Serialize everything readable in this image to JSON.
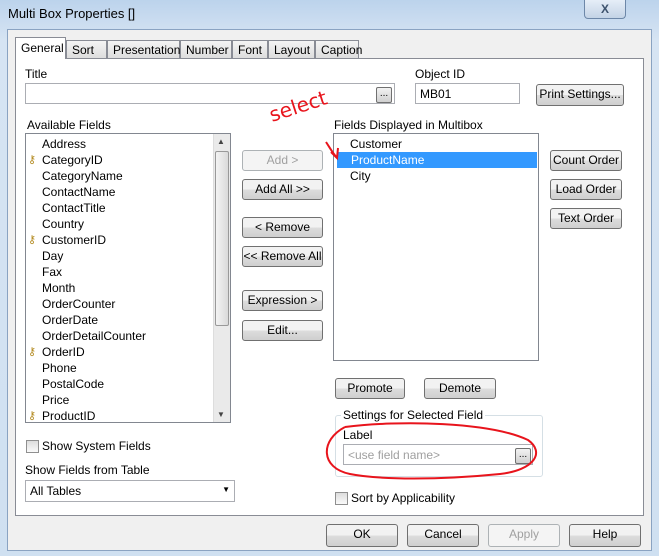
{
  "window": {
    "title": "Multi Box Properties []",
    "close": "X"
  },
  "tabs": [
    "General",
    "Sort",
    "Presentation",
    "Number",
    "Font",
    "Layout",
    "Caption"
  ],
  "title_label": "Title",
  "title_value": "",
  "browse": "...",
  "object_id_label": "Object ID",
  "object_id_value": "MB01",
  "print_settings": "Print Settings...",
  "available_label": "Available Fields",
  "available_fields": [
    {
      "name": "Address",
      "key": false
    },
    {
      "name": "CategoryID",
      "key": true
    },
    {
      "name": "CategoryName",
      "key": false
    },
    {
      "name": "ContactName",
      "key": false
    },
    {
      "name": "ContactTitle",
      "key": false
    },
    {
      "name": "Country",
      "key": false
    },
    {
      "name": "CustomerID",
      "key": true
    },
    {
      "name": "Day",
      "key": false
    },
    {
      "name": "Fax",
      "key": false
    },
    {
      "name": "Month",
      "key": false
    },
    {
      "name": "OrderCounter",
      "key": false
    },
    {
      "name": "OrderDate",
      "key": false
    },
    {
      "name": "OrderDetailCounter",
      "key": false
    },
    {
      "name": "OrderID",
      "key": true
    },
    {
      "name": "Phone",
      "key": false
    },
    {
      "name": "PostalCode",
      "key": false
    },
    {
      "name": "Price",
      "key": false
    },
    {
      "name": "ProductID",
      "key": true
    }
  ],
  "buttons": {
    "add": "Add >",
    "add_all": "Add All >>",
    "remove": "< Remove",
    "remove_all": "<< Remove All",
    "expression": "Expression >",
    "edit": "Edit...",
    "count_order": "Count Order",
    "load_order": "Load Order",
    "text_order": "Text Order",
    "promote": "Promote",
    "demote": "Demote",
    "ok": "OK",
    "cancel": "Cancel",
    "apply": "Apply",
    "help": "Help"
  },
  "displayed_label": "Fields Displayed in Multibox",
  "displayed_fields": [
    "Customer",
    "ProductName",
    "City"
  ],
  "selected_field": "ProductName",
  "settings_group": "Settings for Selected Field",
  "label_label": "Label",
  "label_placeholder": "<use field name>",
  "show_system_fields": "Show System Fields",
  "show_from_table_label": "Show Fields from Table",
  "show_from_table_value": "All Tables",
  "sort_by_applicability": "Sort by Applicability",
  "annotation": "select",
  "colors": {
    "selection": "#3399ff",
    "annotation": "#e8141c"
  }
}
